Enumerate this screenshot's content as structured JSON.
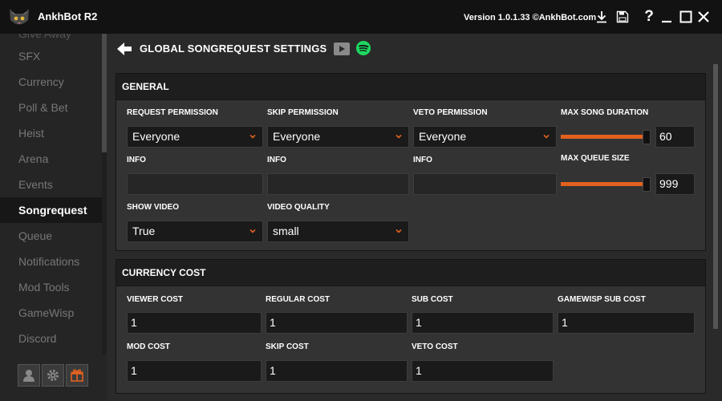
{
  "window": {
    "title": "AnkhBot R2",
    "version": "Version 1.0.1.33 ©AnkhBot.com"
  },
  "sidebar": {
    "items": [
      {
        "label": "Give Away",
        "active": false
      },
      {
        "label": "SFX",
        "active": false
      },
      {
        "label": "Currency",
        "active": false
      },
      {
        "label": "Poll & Bet",
        "active": false
      },
      {
        "label": "Heist",
        "active": false
      },
      {
        "label": "Arena",
        "active": false
      },
      {
        "label": "Events",
        "active": false
      },
      {
        "label": "Songrequest",
        "active": true
      },
      {
        "label": "Queue",
        "active": false
      },
      {
        "label": "Notifications",
        "active": false
      },
      {
        "label": "Mod Tools",
        "active": false
      },
      {
        "label": "GameWisp",
        "active": false
      },
      {
        "label": "Discord",
        "active": false
      }
    ]
  },
  "page": {
    "title": "GLOBAL SONGREQUEST SETTINGS"
  },
  "general": {
    "heading": "GENERAL",
    "request_permission": {
      "label": "REQUEST PERMISSION",
      "value": "Everyone"
    },
    "skip_permission": {
      "label": "SKIP PERMISSION",
      "value": "Everyone"
    },
    "veto_permission": {
      "label": "VETO PERMISSION",
      "value": "Everyone"
    },
    "max_song_duration": {
      "label": "MAX SONG DURATION",
      "value": "60"
    },
    "info_label": "INFO",
    "max_queue_size": {
      "label": "MAX QUEUE SIZE",
      "value": "999"
    },
    "show_video": {
      "label": "SHOW VIDEO",
      "value": "True"
    },
    "video_quality": {
      "label": "VIDEO QUALITY",
      "value": "small"
    }
  },
  "currency_cost": {
    "heading": "CURRENCY COST",
    "viewer_cost": {
      "label": "VIEWER COST",
      "value": "1"
    },
    "regular_cost": {
      "label": "REGULAR COST",
      "value": "1"
    },
    "sub_cost": {
      "label": "SUB COST",
      "value": "1"
    },
    "gamewisp_sub_cost": {
      "label": "GAMEWISP SUB COST",
      "value": "1"
    },
    "mod_cost": {
      "label": "MOD COST",
      "value": "1"
    },
    "skip_cost": {
      "label": "SKIP COST",
      "value": "1"
    },
    "veto_cost": {
      "label": "VETO COST",
      "value": "1"
    }
  },
  "colors": {
    "accent": "#e2611e",
    "spotify": "#1ed760",
    "background": "#2a2a2a"
  },
  "icons": [
    "cat-logo-icon",
    "download-icon",
    "save-icon",
    "help-icon",
    "minimize-icon",
    "maximize-icon",
    "close-icon",
    "back-arrow-icon",
    "youtube-icon",
    "spotify-icon",
    "user-icon",
    "gear-icon",
    "gift-icon",
    "chevron-down-icon"
  ]
}
